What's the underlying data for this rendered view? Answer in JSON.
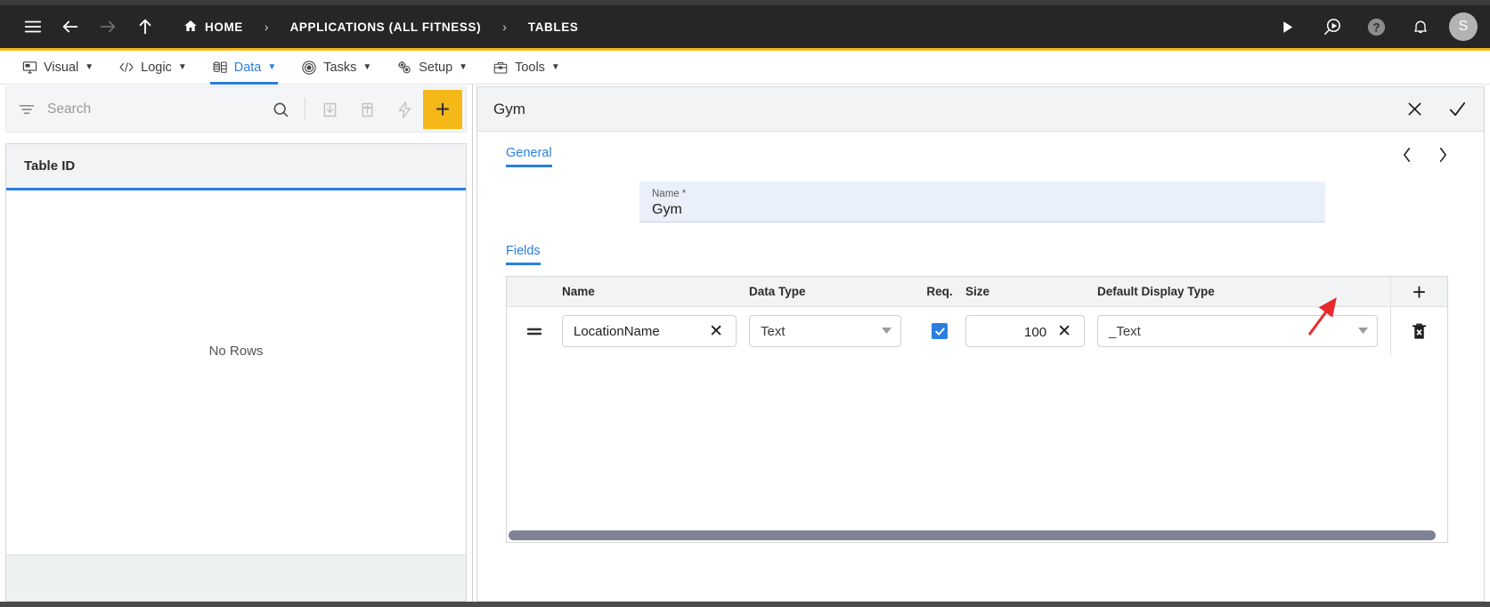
{
  "topbar": {
    "nav_icons": [
      {
        "name": "hamburger-menu-icon",
        "glyph": "☰"
      },
      {
        "name": "back-arrow-icon",
        "glyph": "←"
      },
      {
        "name": "forward-arrow-icon",
        "glyph": "→"
      },
      {
        "name": "up-arrow-icon",
        "glyph": "↑"
      }
    ],
    "breadcrumbs": [
      {
        "label": "HOME",
        "icon": "home-icon"
      },
      {
        "label": "APPLICATIONS (ALL FITNESS)",
        "icon": ""
      },
      {
        "label": "TABLES",
        "icon": ""
      }
    ],
    "separator": "›",
    "actions": [
      {
        "name": "run-play-icon",
        "glyph": "▶"
      },
      {
        "name": "search-play-icon",
        "glyph": ""
      },
      {
        "name": "help-icon",
        "glyph": "?"
      },
      {
        "name": "notifications-bell-icon",
        "glyph": ""
      }
    ],
    "avatar_initial": "S",
    "accent_color": "#f5b819",
    "background_color": "#262626"
  },
  "menubar": {
    "items": [
      {
        "label": "Visual",
        "icon": "monitor-icon",
        "active": false
      },
      {
        "label": "Logic",
        "icon": "code-brackets-icon",
        "active": false
      },
      {
        "label": "Data",
        "icon": "database-stack-icon",
        "active": true
      },
      {
        "label": "Tasks",
        "icon": "target-icon",
        "active": false
      },
      {
        "label": "Setup",
        "icon": "gears-icon",
        "active": false
      },
      {
        "label": "Tools",
        "icon": "toolbox-icon",
        "active": false
      }
    ],
    "caret": "▼",
    "active_color": "#2a7fe0"
  },
  "left_panel": {
    "search": {
      "placeholder": "Search",
      "value": ""
    },
    "toolbar": [
      {
        "name": "filter-icon"
      },
      {
        "name": "search-icon"
      },
      {
        "name": "import-download-icon"
      },
      {
        "name": "export-upload-icon"
      },
      {
        "name": "quick-action-lightning-icon"
      },
      {
        "name": "add-record-button",
        "label": "+"
      }
    ],
    "grid": {
      "columns": [
        "Table ID"
      ],
      "rows": [],
      "empty_message": "No Rows"
    }
  },
  "right_panel": {
    "title": "Gym",
    "header_actions": [
      {
        "name": "close-button",
        "glyph": "✕"
      },
      {
        "name": "confirm-save-button",
        "glyph": "✓"
      }
    ],
    "tabs": [
      {
        "label": "General",
        "active": true
      }
    ],
    "nav": {
      "prev": "‹",
      "next": "›"
    },
    "name_field": {
      "label": "Name *",
      "value": "Gym"
    },
    "fields_section": {
      "tab_label": "Fields",
      "columns": [
        "",
        "Name",
        "Data Type",
        "Req.",
        "Size",
        "Default Display Type",
        ""
      ],
      "add_row_label": "+",
      "rows": [
        {
          "drag_handle": "≡",
          "name": "LocationName",
          "name_clear": "✕",
          "data_type": "Text",
          "required": true,
          "size": "100",
          "size_clear": "✕",
          "default_display_type": "_Text",
          "delete_icon": "delete-trash-icon"
        }
      ]
    },
    "scrollbar": {
      "orientation": "horizontal",
      "thumb_color": "#7e8496"
    }
  },
  "annotation": {
    "arrow_color": "#e8292b",
    "points_to": "add-field-row-button"
  }
}
